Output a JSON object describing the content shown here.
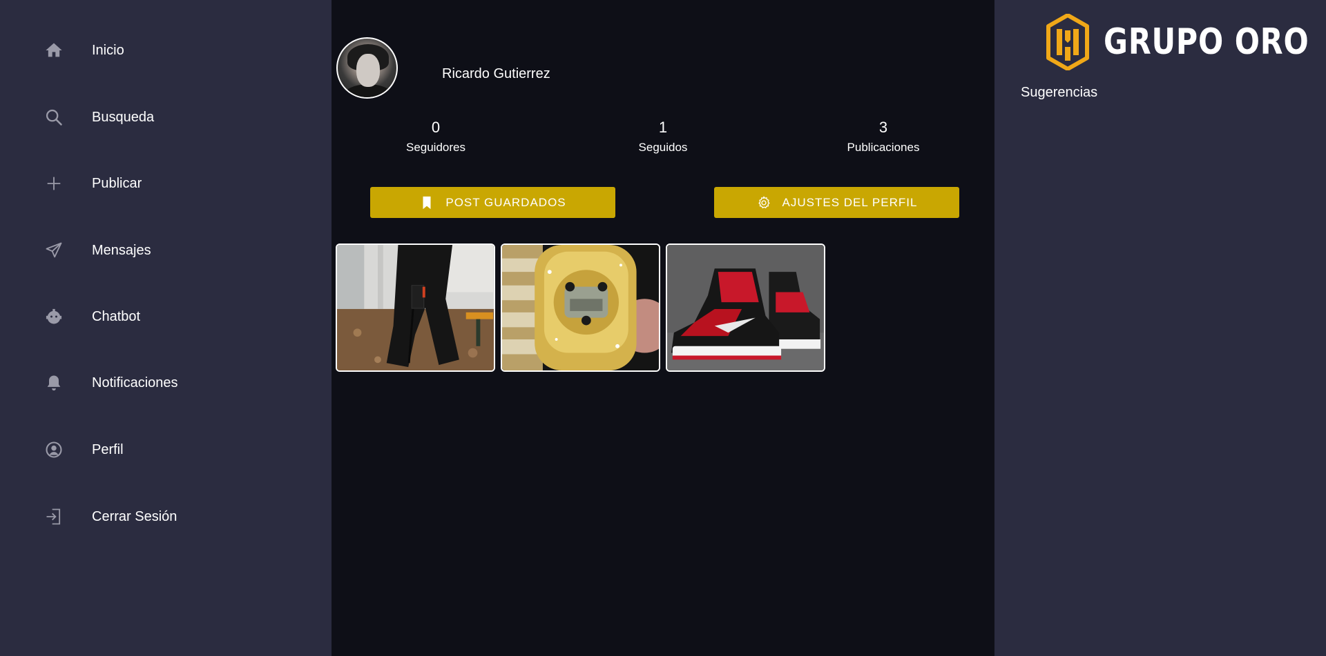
{
  "sidebar": {
    "items": [
      {
        "label": "Inicio",
        "icon": "home-icon"
      },
      {
        "label": "Busqueda",
        "icon": "search-icon"
      },
      {
        "label": "Publicar",
        "icon": "plus-icon"
      },
      {
        "label": "Mensajes",
        "icon": "send-icon"
      },
      {
        "label": "Chatbot",
        "icon": "robot-icon"
      },
      {
        "label": "Notificaciones",
        "icon": "bell-icon"
      },
      {
        "label": "Perfil",
        "icon": "user-circle-icon"
      },
      {
        "label": "Cerrar Sesión",
        "icon": "logout-icon"
      }
    ]
  },
  "profile": {
    "username": "Ricardo Gutierrez",
    "stats": [
      {
        "value": "0",
        "label": "Seguidores"
      },
      {
        "value": "1",
        "label": "Seguidos"
      },
      {
        "value": "3",
        "label": "Publicaciones"
      }
    ],
    "buttons": {
      "saved": {
        "label": "POST GUARDADOS",
        "icon": "bookmark-icon"
      },
      "settings": {
        "label": "AJUSTES DEL PERFIL",
        "icon": "gear-icon"
      }
    },
    "posts": [
      {
        "subject": "black cargo pants"
      },
      {
        "subject": "iced gold watch"
      },
      {
        "subject": "red and black sneakers"
      }
    ]
  },
  "right": {
    "logo_text": "GRUPO ORO",
    "suggestions_title": "Sugerencias"
  },
  "colors": {
    "sidebar_bg": "#2b2c40",
    "main_bg": "#0e0f17",
    "accent_gold": "#c9a702",
    "logo_orange": "#f0a818",
    "icon_gray": "#9a9aa8"
  }
}
